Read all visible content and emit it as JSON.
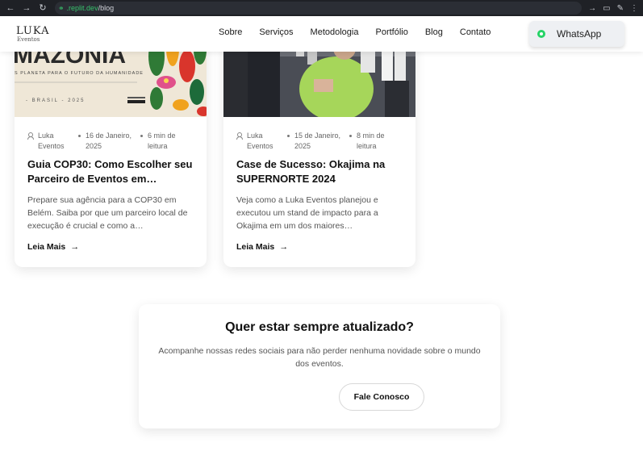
{
  "browser": {
    "url_host": ".replit.dev",
    "url_path": "/blog"
  },
  "header": {
    "logo_brand": "LUKA",
    "logo_sub": "Eventos",
    "nav": [
      "Sobre",
      "Serviços",
      "Metodologia",
      "Portfólio",
      "Blog",
      "Contato"
    ],
    "whatsapp_label": "WhatsApp"
  },
  "posts": [
    {
      "thumb_text": "MAZÔNIA",
      "thumb_sub": "S PLANETA PARA O FUTURO DA HUMANIDADE",
      "thumb_footer": "- BRASIL - 2025",
      "author": "Luka Eventos",
      "date": "16 de Janeiro, 2025",
      "read_time": "6 min de leitura",
      "title": "Guia COP30: Como Escolher seu Parceiro de Eventos em…",
      "excerpt": "Prepare sua agência para a COP30 em Belém. Saiba por que um parceiro local de execução é crucial e como a…",
      "read_more": "Leia Mais"
    },
    {
      "author": "Luka Eventos",
      "date": "15 de Janeiro, 2025",
      "read_time": "8 min de leitura",
      "title": "Case de Sucesso: Okajima na SUPERNORTE 2024",
      "excerpt": "Veja como a Luka Eventos planejou e executou um stand de impacto para a Okajima em um dos maiores…",
      "read_more": "Leia Mais"
    }
  ],
  "cta": {
    "title": "Quer estar sempre atualizado?",
    "text": "Acompanhe nossas redes sociais para não perder nenhuma novidade sobre o mundo dos eventos.",
    "button": "Fale Conosco"
  }
}
